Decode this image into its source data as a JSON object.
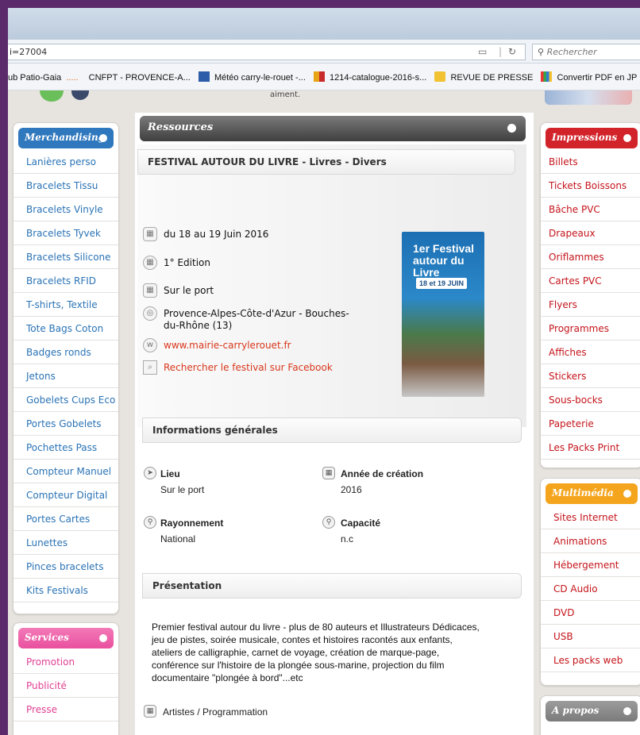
{
  "browser": {
    "url": "i=27004",
    "search_placeholder": "Rechercher",
    "bookmarks": [
      {
        "label": "ub Patio-Gaia",
        "color": ""
      },
      {
        "label": "CNFPT - PROVENCE-A...",
        "color": ""
      },
      {
        "label": "Météo carry-le-rouet -...",
        "color": "#2d5ca8"
      },
      {
        "label": "1214-catalogue-2016-s...",
        "color": "#e8a317"
      },
      {
        "label": "REVUE DE PRESSE",
        "color": "#f1c232"
      },
      {
        "label": "Convertir PDF en JP",
        "color": "#3aa34a"
      }
    ],
    "bookmark_separator": "....."
  },
  "left_sidebar": {
    "title": "Merchandising",
    "color": "#2f78bd",
    "items": [
      "Lanières perso",
      "Bracelets Tissu",
      "Bracelets Vinyle",
      "Bracelets Tyvek",
      "Bracelets Silicone",
      "Bracelets RFID",
      "T-shirts, Textile",
      "Tote Bags Coton",
      "Badges ronds",
      "Jetons",
      "Gobelets Cups Eco",
      "Portes Gobelets",
      "Pochettes Pass",
      "Compteur Manuel",
      "Compteur Digital",
      "Portes Cartes",
      "Lunettes",
      "Pinces bracelets",
      "Kits Festivals"
    ]
  },
  "services_sidebar": {
    "title": "Services",
    "color": "#e94f9e",
    "items": [
      "Promotion",
      "Publicité",
      "Presse"
    ]
  },
  "right_impressions": {
    "title": "Impressions",
    "color": "#d2232a",
    "items": [
      "Billets",
      "Tickets Boissons",
      "Bâche PVC",
      "Drapeaux",
      "Oriflammes",
      "Cartes PVC",
      "Flyers",
      "Programmes",
      "Affiches",
      "Stickers",
      "Sous-bocks",
      "Papeterie",
      "Les Packs Print"
    ]
  },
  "right_multimedia": {
    "title": "Multimédia",
    "color": "#f5a51d",
    "items": [
      "Sites Internet",
      "Animations",
      "Hébergement",
      "CD Audio",
      "DVD",
      "USB",
      "Les packs web"
    ]
  },
  "right_apropos": {
    "title": "A propos",
    "color": "#8a8a8a"
  },
  "main": {
    "section_title": "Ressources",
    "event_title": "FESTIVAL AUTOUR DU LIVRE -  Livres - Divers",
    "dates": "du  18 au 19 Juin 2016",
    "edition": "1° Edition",
    "location": "Sur le port",
    "region": "Provence-Alpes-Côte-d'Azur - Bouches-du-Rhône (13)",
    "website": "www.mairie-carrylerouet.fr",
    "facebook": "Rechercher le festival sur Facebook",
    "poster_title": "1er Festival autour du Livre",
    "poster_dates": "18 et 19 JUIN",
    "info_title": "Informations générales",
    "lieu_label": "Lieu",
    "lieu_value": "Sur le port",
    "annee_label": "Année de création",
    "annee_value": "2016",
    "rayonnement_label": "Rayonnement",
    "rayonnement_value": "National",
    "capacite_label": "Capacité",
    "capacite_value": "n.c",
    "presentation_title": "Présentation",
    "presentation_text": "Premier festival autour du livre - plus de 80 auteurs et Illustrateurs Dédicaces, jeu de pistes, soirée musicale, contes et histoires racontés aux enfants, ateliers de calligraphie, carnet de voyage, création de marque-page, conférence sur l'histoire de la plongée sous-marine, projection du film documentaire \"plongée à bord\"...etc",
    "artistes_label": "Artistes / Programmation",
    "top_fragment": "aiment."
  }
}
